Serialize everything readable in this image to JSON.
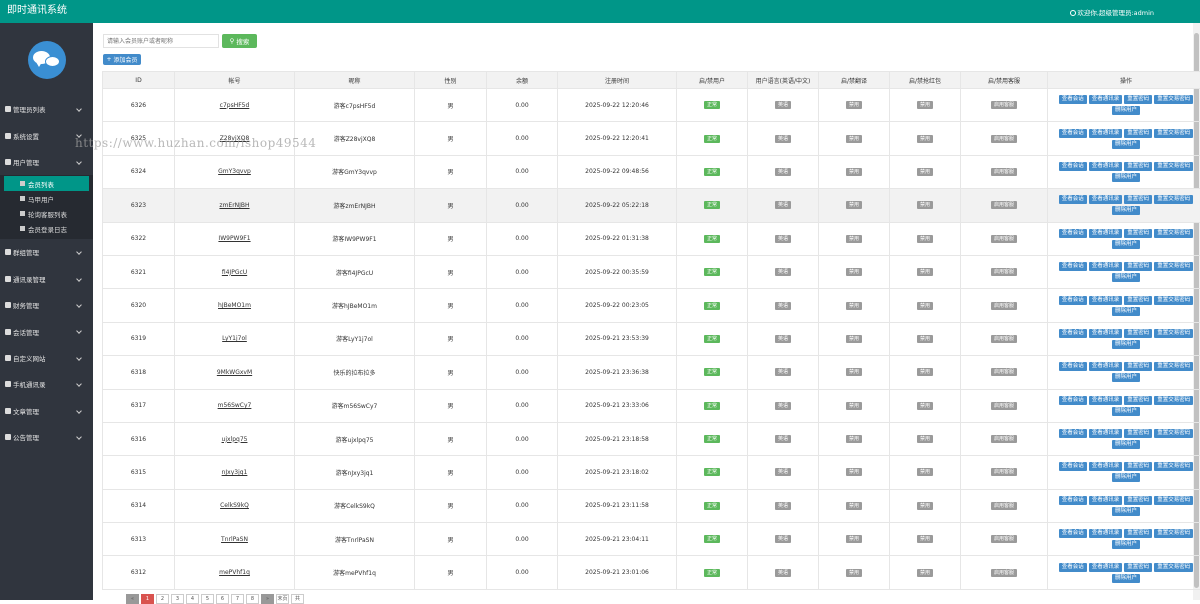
{
  "app": {
    "title": "即时通讯系统",
    "welcome": "欢迎你,超级管理员:admin"
  },
  "sidebar": {
    "items": [
      {
        "label": "管理员列表"
      },
      {
        "label": "系统设置"
      },
      {
        "label": "用户管理"
      },
      {
        "label": "群组管理"
      },
      {
        "label": "通讯录管理"
      },
      {
        "label": "财务管理"
      },
      {
        "label": "会话管理"
      },
      {
        "label": "自定义网站"
      },
      {
        "label": "手机通讯录"
      },
      {
        "label": "文章管理"
      },
      {
        "label": "公告管理"
      }
    ],
    "sub_items": [
      {
        "label": "会员列表"
      },
      {
        "label": "马甲用户"
      },
      {
        "label": "轮询客服列表"
      },
      {
        "label": "会员登录日志"
      }
    ]
  },
  "toolbar": {
    "search_placeholder": "请输入会员账户或者昵称",
    "search_label": "搜索",
    "add_label": "添加会员"
  },
  "table": {
    "headers": [
      "ID",
      "帐号",
      "昵称",
      "性别",
      "余额",
      "注册时间",
      "启/禁用户",
      "用户语言(英语/中文)",
      "启/禁翻译",
      "启/禁抢红包",
      "启/禁用客服",
      "操作"
    ],
    "rows": [
      {
        "id": "6326",
        "account": "c7psHF5d",
        "nickname": "游客c7psHF5d",
        "gender": "男",
        "balance": "0.00",
        "time": "2025-09-22 12:20:46"
      },
      {
        "id": "6325",
        "account": "Z28vjXQ8",
        "nickname": "游客Z28vjXQ8",
        "gender": "男",
        "balance": "0.00",
        "time": "2025-09-22 12:20:41"
      },
      {
        "id": "6324",
        "account": "GmY3qvvp",
        "nickname": "游客GmY3qvvp",
        "gender": "男",
        "balance": "0.00",
        "time": "2025-09-22 09:48:56"
      },
      {
        "id": "6323",
        "account": "zmErNJBH",
        "nickname": "游客zmErNJBH",
        "gender": "男",
        "balance": "0.00",
        "time": "2025-09-22 05:22:18"
      },
      {
        "id": "6322",
        "account": "IW9PW9F1",
        "nickname": "游客IW9PW9F1",
        "gender": "男",
        "balance": "0.00",
        "time": "2025-09-22 01:31:38"
      },
      {
        "id": "6321",
        "account": "fi4JPGcU",
        "nickname": "游客fi4JPGcU",
        "gender": "男",
        "balance": "0.00",
        "time": "2025-09-22 00:35:59"
      },
      {
        "id": "6320",
        "account": "hJBeMO1m",
        "nickname": "游客hJBeMO1m",
        "gender": "男",
        "balance": "0.00",
        "time": "2025-09-22 00:23:05"
      },
      {
        "id": "6319",
        "account": "LyY1j7ol",
        "nickname": "游客LyY1j7ol",
        "gender": "男",
        "balance": "0.00",
        "time": "2025-09-21 23:53:39"
      },
      {
        "id": "6318",
        "account": "9MkWGxvM",
        "nickname": "快乐的拉布拉多",
        "gender": "男",
        "balance": "0.00",
        "time": "2025-09-21 23:36:38"
      },
      {
        "id": "6317",
        "account": "m56SwCy7",
        "nickname": "游客m56SwCy7",
        "gender": "男",
        "balance": "0.00",
        "time": "2025-09-21 23:33:06"
      },
      {
        "id": "6316",
        "account": "ujxlpq75",
        "nickname": "游客ujxlpq75",
        "gender": "男",
        "balance": "0.00",
        "time": "2025-09-21 23:18:58"
      },
      {
        "id": "6315",
        "account": "nJxy3jq1",
        "nickname": "游客nJxy3jq1",
        "gender": "男",
        "balance": "0.00",
        "time": "2025-09-21 23:18:02"
      },
      {
        "id": "6314",
        "account": "CelkS9kQ",
        "nickname": "游客CelkS9kQ",
        "gender": "男",
        "balance": "0.00",
        "time": "2025-09-21 23:11:58"
      },
      {
        "id": "6313",
        "account": "TnrlPaSN",
        "nickname": "游客TnrlPaSN",
        "gender": "男",
        "balance": "0.00",
        "time": "2025-09-21 23:04:11"
      },
      {
        "id": "6312",
        "account": "mePVhf1q",
        "nickname": "游客mePVhf1q",
        "gender": "男",
        "balance": "0.00",
        "time": "2025-09-21 23:01:06"
      }
    ],
    "tags": {
      "status": "正常",
      "language": "英语",
      "translate": "禁用",
      "redpacket": "禁用",
      "service": "启用客服"
    },
    "ops": [
      "查看会话",
      "查看通讯录",
      "重置密码",
      "重置交易密码",
      "删除用户"
    ]
  },
  "pager": {
    "pages": [
      "«",
      "1",
      "2",
      "3",
      "4",
      "5",
      "6",
      "7",
      "8",
      "»",
      "末页",
      "共"
    ]
  },
  "watermark": "https://www.huzhan.com/ishop49544",
  "colors": {
    "brand": "#009688",
    "sidebar": "#30353e",
    "primary": "#428bca",
    "success": "#5cb85c",
    "disabled": "#9a9a9a"
  }
}
